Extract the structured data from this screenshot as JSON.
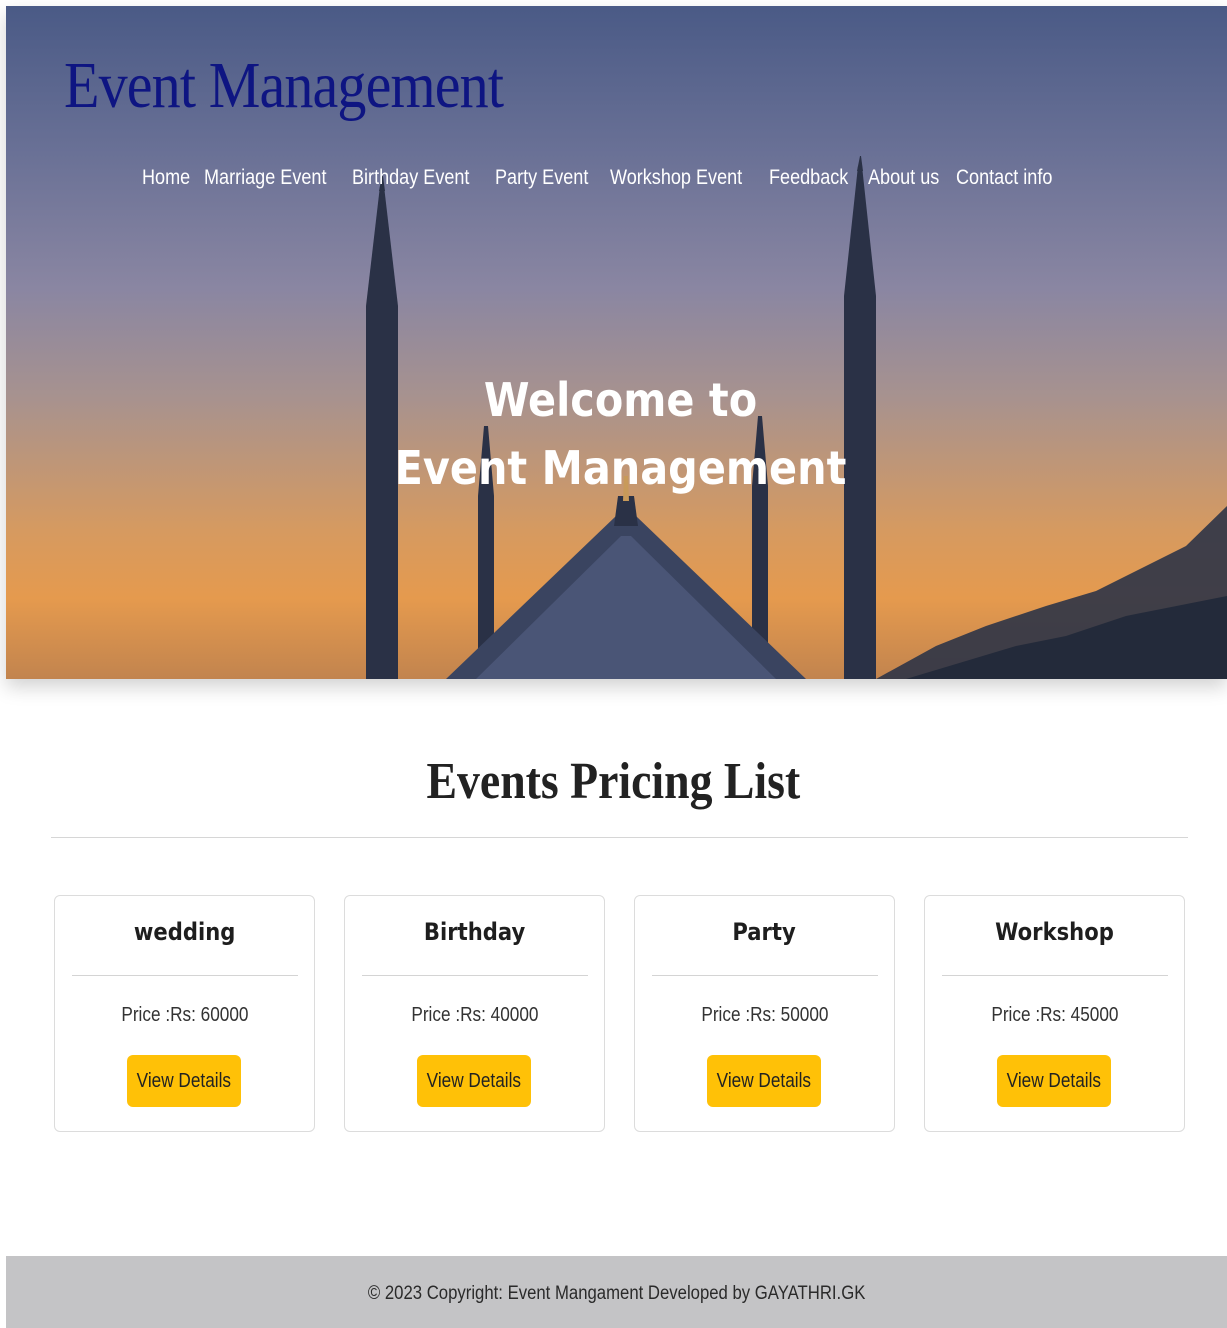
{
  "header": {
    "brand": "Event Management",
    "nav": [
      {
        "label": "Home"
      },
      {
        "label": "Marriage Event"
      },
      {
        "label": "Birthday Event"
      },
      {
        "label": "Party Event"
      },
      {
        "label": "Workshop Event"
      },
      {
        "label": "Feedback"
      },
      {
        "label": "About us"
      },
      {
        "label": "Contact info"
      }
    ]
  },
  "hero": {
    "line1": "Welcome to",
    "line2": "Event Management"
  },
  "pricing": {
    "title": "Events Pricing List",
    "cards": [
      {
        "title": "wedding",
        "price": "Price :Rs: 60000",
        "button": "View Details"
      },
      {
        "title": "Birthday",
        "price": "Price :Rs: 40000",
        "button": "View Details"
      },
      {
        "title": "Party",
        "price": "Price :Rs: 50000",
        "button": "View Details"
      },
      {
        "title": "Workshop",
        "price": "Price :Rs: 45000",
        "button": "View Details"
      }
    ]
  },
  "footer": {
    "text": "© 2023 Copyright: Event Mangament Developed by GAYATHRI.GK"
  },
  "colors": {
    "brand": "#0e1582",
    "button": "#ffc107",
    "footer_bg": "#c4c4c6"
  }
}
